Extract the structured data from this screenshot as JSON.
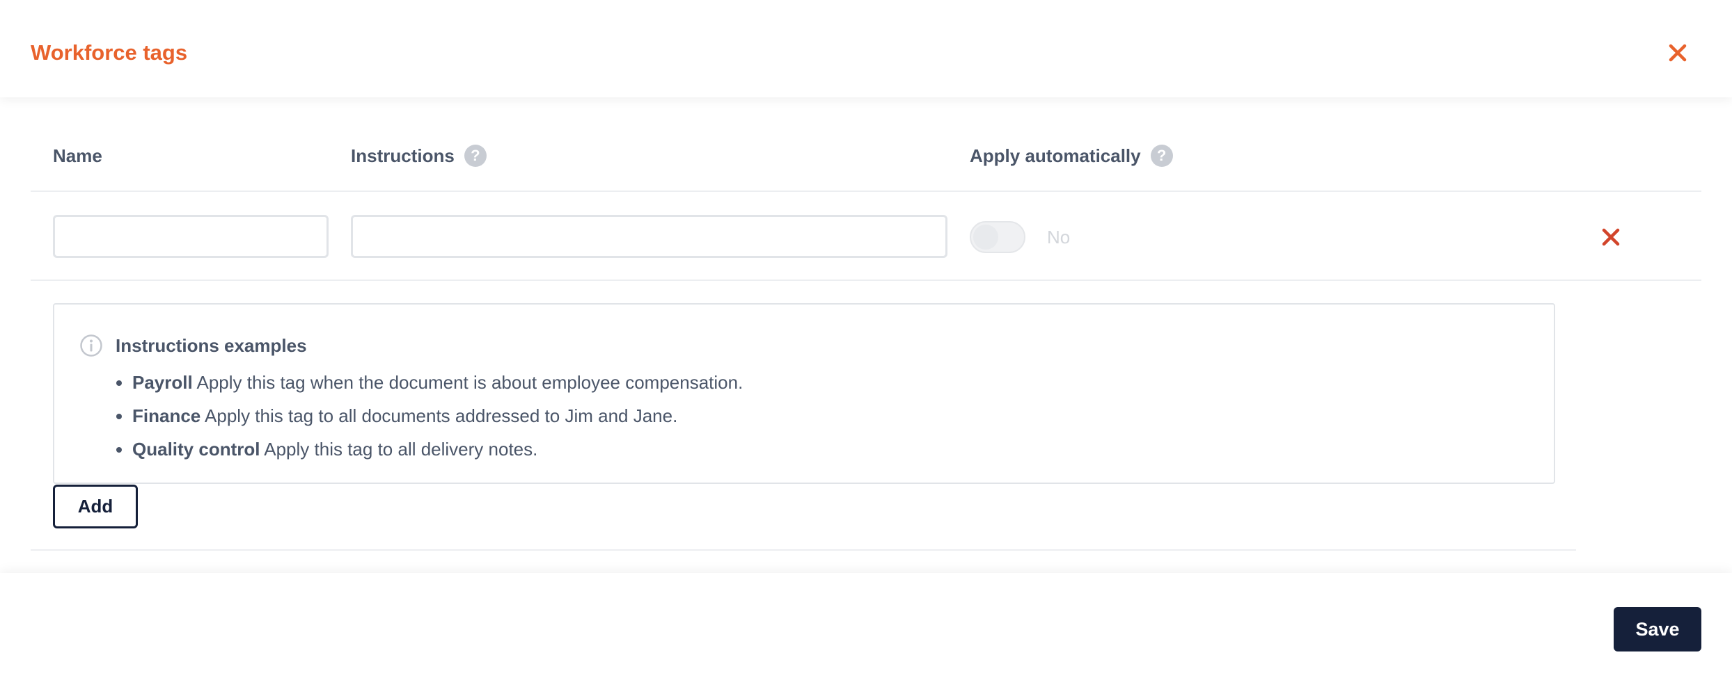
{
  "header": {
    "title": "Workforce tags",
    "close_icon": "close-icon",
    "accent_color": "#e8622c"
  },
  "columns": {
    "name": "Name",
    "instructions": "Instructions",
    "apply_automatically": "Apply automatically",
    "help_icon_glyph": "?"
  },
  "row": {
    "name_value": "",
    "instructions_value": "",
    "auto_apply_state": "No",
    "auto_apply_on": false,
    "delete_icon": "close-icon"
  },
  "examples": {
    "title": "Instructions examples",
    "items": [
      {
        "tag": "Payroll",
        "text": " Apply this tag when the document is about employee compensation."
      },
      {
        "tag": "Finance",
        "text": " Apply this tag to all documents addressed to Jim and Jane."
      },
      {
        "tag": "Quality control",
        "text": " Apply this tag to all delivery notes."
      }
    ]
  },
  "actions": {
    "add_label": "Add",
    "save_label": "Save",
    "primary_color": "#15203a"
  }
}
